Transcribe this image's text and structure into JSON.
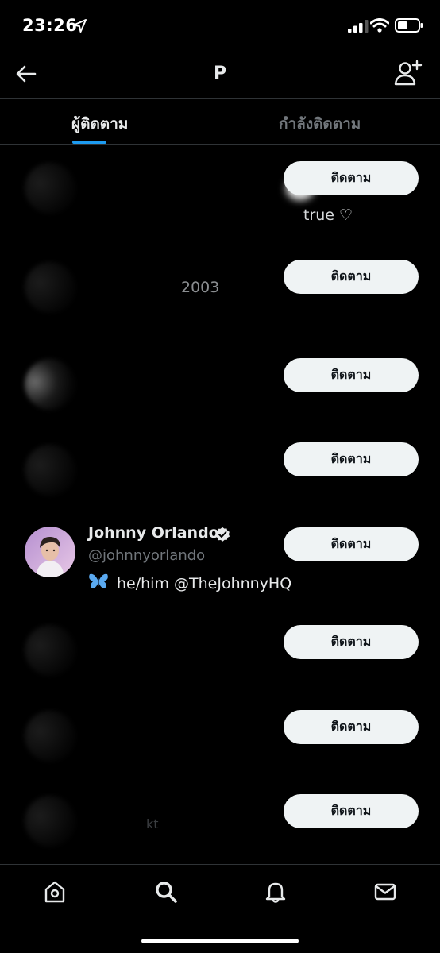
{
  "status_bar": {
    "time": "23:26",
    "icons": [
      "location-arrow-icon",
      "signal-icon",
      "wifi-icon",
      "battery-icon"
    ]
  },
  "header": {
    "title": "P",
    "back_icon": "back-arrow-icon",
    "add_user_icon": "add-user-icon"
  },
  "tabs": [
    {
      "label": "ผู้ติดตาม",
      "active": true
    },
    {
      "label": "กำลังติดตาม",
      "active": false
    }
  ],
  "list": {
    "partial_texts": [
      "true ♡",
      "2003",
      "kt"
    ],
    "follow_label": "ติดตาม",
    "featured_user": {
      "name": "Johnny Orlando",
      "handle": "@johnnyorlando",
      "verified": true,
      "bio_emoji": "butterfly-icon",
      "bio": "he/him @TheJohnnyHQ"
    }
  },
  "bottom_nav": {
    "items": [
      "home-icon",
      "search-icon",
      "notifications-icon",
      "messages-icon"
    ]
  },
  "colors": {
    "background": "#000000",
    "accent": "#1d9bf0",
    "button_bg": "#eff3f4",
    "button_text": "#0f1419",
    "muted": "#71767b"
  }
}
